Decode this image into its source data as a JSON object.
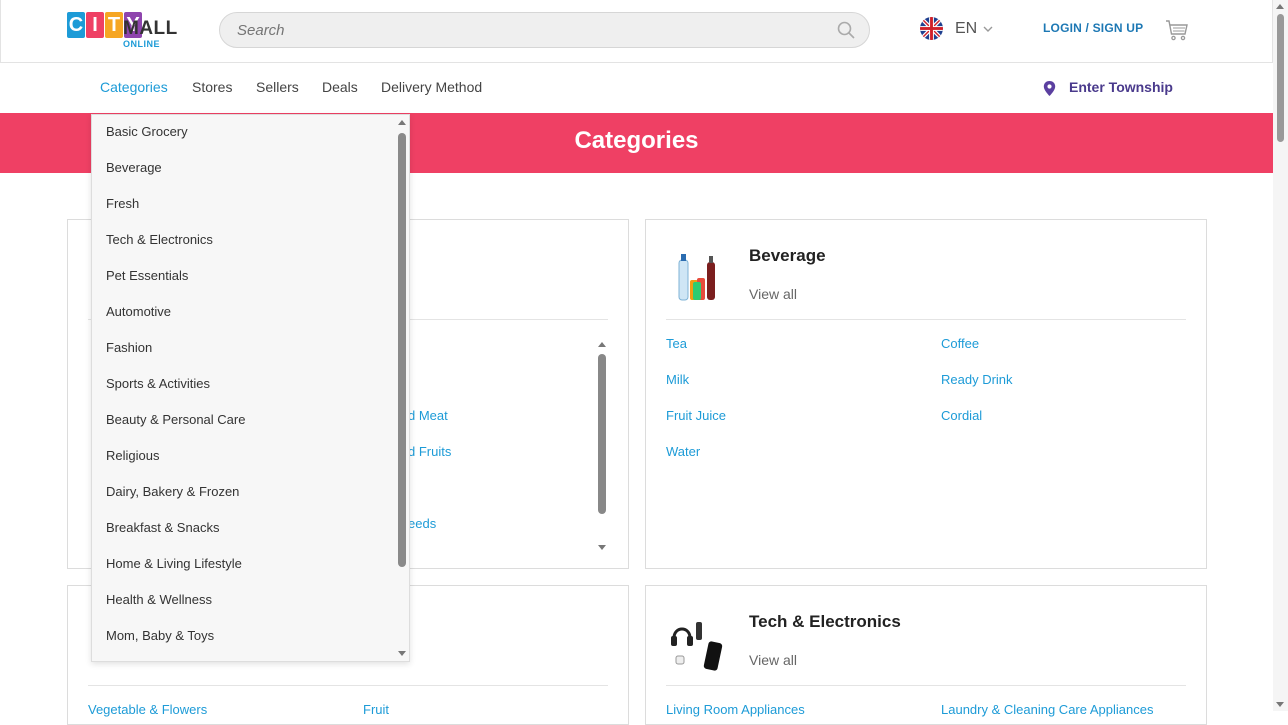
{
  "brand": {
    "logo_letters": [
      "C",
      "I",
      "T",
      "Y"
    ],
    "logo_colors": [
      "#1d9bd7",
      "#ef4064",
      "#f6a623",
      "#8e44ad"
    ],
    "logo_word": "MALL",
    "logo_sub": "ONLINE"
  },
  "search": {
    "placeholder": "Search"
  },
  "language": {
    "code": "EN"
  },
  "auth": {
    "login_label": "LOGIN / SIGN UP"
  },
  "nav": {
    "items": [
      "Categories",
      "Stores",
      "Sellers",
      "Deals",
      "Delivery Method"
    ],
    "active": "Categories",
    "township_label": "Enter Township"
  },
  "banner": {
    "title": "Categories",
    "color": "#ef4064"
  },
  "dropdown": {
    "items": [
      "Basic Grocery",
      "Beverage",
      "Fresh",
      "Tech & Electronics",
      "Pet Essentials",
      "Automotive",
      "Fashion",
      "Sports & Activities",
      "Beauty & Personal Care",
      "Religious",
      "Dairy, Bakery & Frozen",
      "Breakfast & Snacks",
      "Home & Living Lifestyle",
      "Health & Wellness",
      "Mom, Baby & Toys"
    ]
  },
  "cards": {
    "partial_left_1": {
      "visible_fragments": [
        "d Meat",
        "d Fruits",
        "eeds"
      ]
    },
    "beverage": {
      "title": "Beverage",
      "view_all": "View all",
      "links": [
        "Tea",
        "Coffee",
        "Milk",
        "Ready Drink",
        "Fruit Juice",
        "Cordial",
        "Water"
      ]
    },
    "fresh_partial": {
      "links": [
        "Vegetable & Flowers",
        "Fruit"
      ]
    },
    "tech": {
      "title": "Tech & Electronics",
      "view_all": "View all",
      "links": [
        "Living Room Appliances",
        "Laundry & Cleaning Care Appliances"
      ]
    }
  },
  "colors": {
    "accent": "#1d9bd7",
    "brand_pink": "#ef4064",
    "township": "#4a3a8c"
  }
}
